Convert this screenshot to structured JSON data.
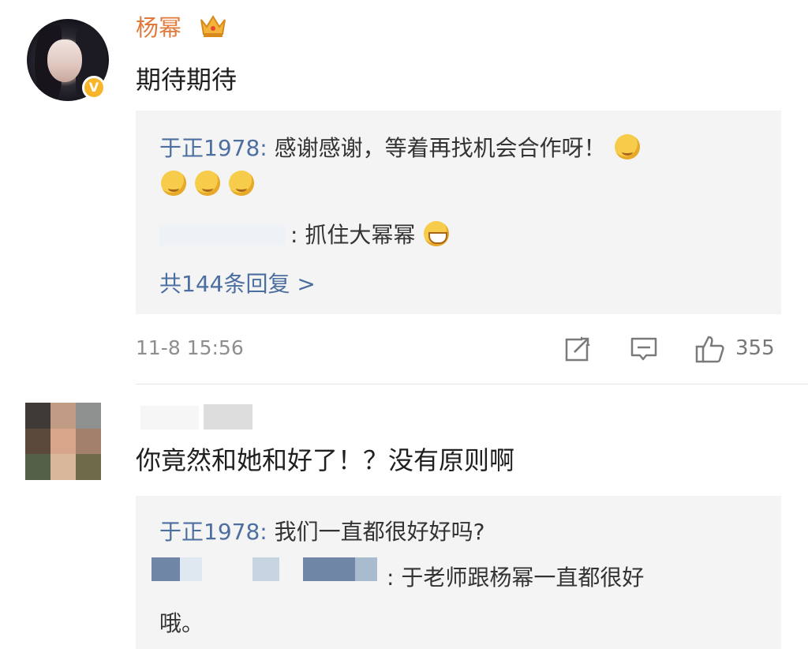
{
  "comment1": {
    "username": "杨幂",
    "username_color": "#e0793a",
    "badge_letter": "V",
    "text": "期待期待",
    "replies": [
      {
        "author": "于正1978",
        "separator": ":",
        "text": " 感谢感谢，等着再找机会合作呀！"
      },
      {
        "author": "",
        "separator": ":",
        "text": " 抓住大幂幂"
      }
    ],
    "more_replies": "共144条回复 >",
    "timestamp": "11-8 15:56",
    "actions": {
      "share_icon": "share-icon",
      "comment_icon": "comment-icon",
      "like_icon": "thumbs-up-icon",
      "like_count": "355"
    }
  },
  "comment2": {
    "text": "你竟然和她和好了！？没有原则啊",
    "replies": [
      {
        "author": "于正1978",
        "separator": ":",
        "text": " 我们一直都很好好吗?"
      },
      {
        "author": "",
        "separator": ":",
        "text": " 于老师跟杨幂一直都很好",
        "text_line2": "哦。"
      }
    ]
  },
  "colors": {
    "link": "#4c6ea0",
    "reply_bg": "#f4f4f4",
    "meta": "#8e8e8e"
  }
}
